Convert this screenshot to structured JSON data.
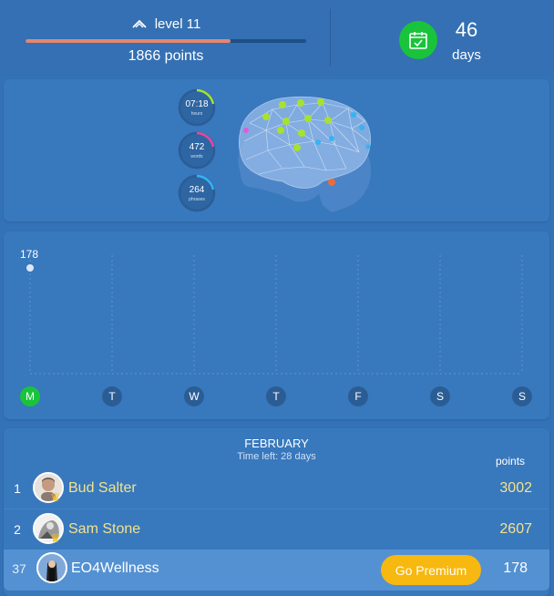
{
  "header": {
    "level_label": "level 11",
    "level_progress": 0.73,
    "points_label": "1866 points",
    "streak_days": "46",
    "days_label": "days"
  },
  "stats": [
    {
      "value": "07:18",
      "unit": "hours",
      "progress": 0.2,
      "color": "#a6e22e"
    },
    {
      "value": "472",
      "unit": "words",
      "progress": 0.2,
      "color": "#e8479a"
    },
    {
      "value": "264",
      "unit": "phrases",
      "progress": 0.2,
      "color": "#34b4f0"
    }
  ],
  "chart_data": {
    "type": "scatter",
    "categories": [
      "M",
      "T",
      "W",
      "T",
      "F",
      "S",
      "S"
    ],
    "values": [
      178,
      null,
      null,
      null,
      null,
      null,
      null
    ],
    "value_labels": [
      "178"
    ],
    "active_day": 0
  },
  "leaderboard": {
    "month": "FEBRUARY",
    "time_left": "Time left: 28 days",
    "points_header": "points",
    "rows": [
      {
        "rank": "1",
        "name": "Bud Salter",
        "score": "3002"
      },
      {
        "rank": "2",
        "name": "Sam Stone",
        "score": "2607"
      },
      {
        "rank": "37",
        "name": "EO4Wellness",
        "score": "178"
      }
    ],
    "premium_label": "Go Premium"
  },
  "colors": {
    "background": "#3372b6",
    "accent_green": "#19c33b",
    "progress": "#e6866e",
    "premium": "#f7b80f",
    "name_yellow": "#f4e38b"
  }
}
